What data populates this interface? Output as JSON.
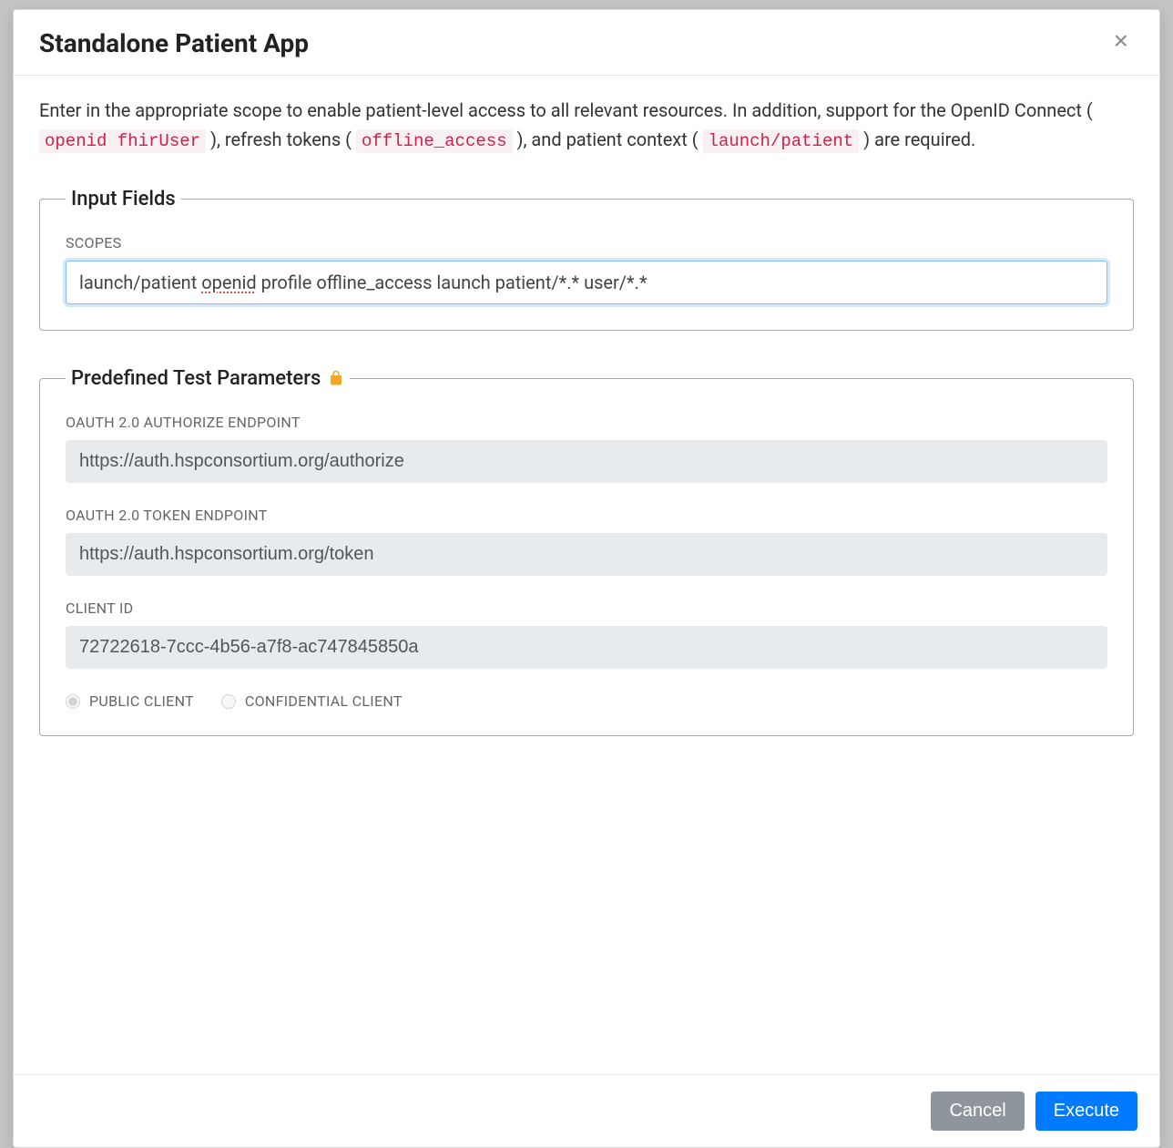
{
  "modal": {
    "title": "Standalone Patient App",
    "intro": {
      "part1": "Enter in the appropriate scope to enable patient-level access to all relevant resources. In addition, support for the OpenID Connect ( ",
      "code1": "openid fhirUser",
      "part2": " ), refresh tokens ( ",
      "code2": "offline_access",
      "part3": " ), and patient context ( ",
      "code3": "launch/patient",
      "part4": " ) are required."
    },
    "input_fields": {
      "legend": "Input Fields",
      "scopes_label": "SCOPES",
      "scopes_value_pre": "launch/patient ",
      "scopes_value_spell": "openid",
      "scopes_value_post": " profile offline_access launch patient/*.* user/*.*"
    },
    "predefined": {
      "legend": "Predefined Test Parameters",
      "authorize_label": "OAUTH 2.0 AUTHORIZE ENDPOINT",
      "authorize_value": "https://auth.hspconsortium.org/authorize",
      "token_label": "OAUTH 2.0 TOKEN ENDPOINT",
      "token_value": "https://auth.hspconsortium.org/token",
      "client_id_label": "CLIENT ID",
      "client_id_value": "72722618-7ccc-4b56-a7f8-ac747845850a",
      "public_client_label": "PUBLIC CLIENT",
      "confidential_client_label": "CONFIDENTIAL CLIENT",
      "selected": "public"
    },
    "footer": {
      "cancel": "Cancel",
      "execute": "Execute"
    }
  }
}
